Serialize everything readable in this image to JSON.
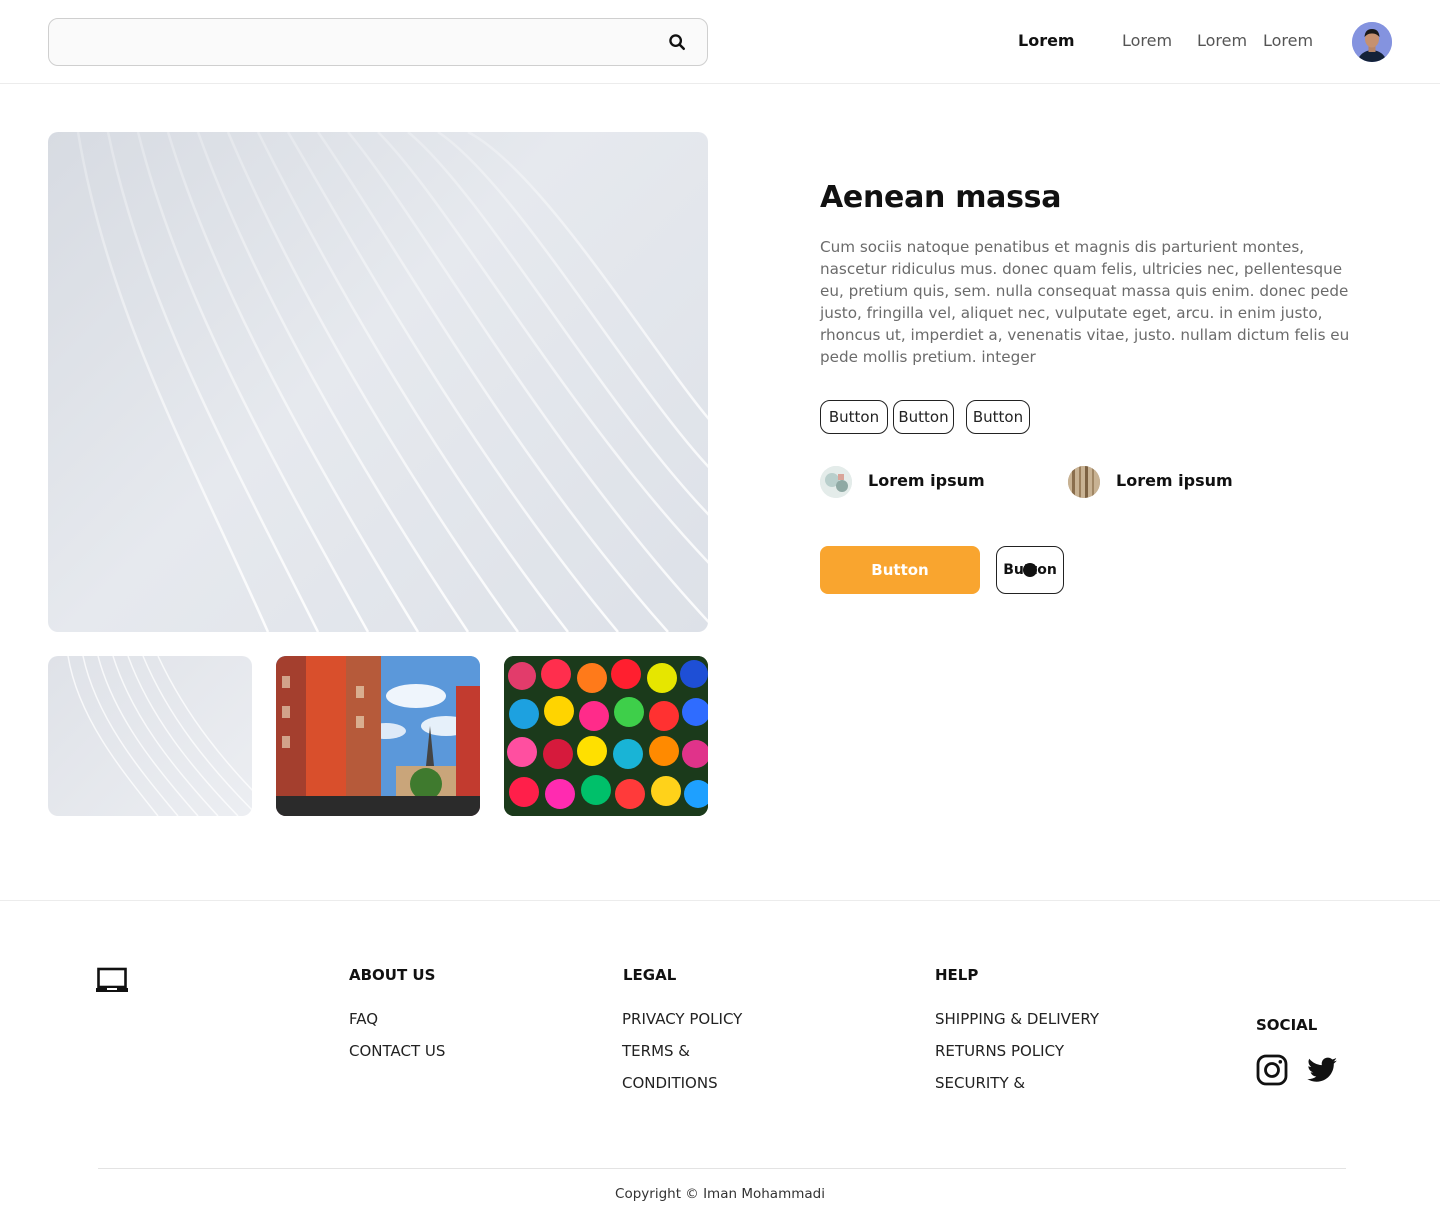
{
  "header": {
    "search": {
      "placeholder": "",
      "value": ""
    },
    "nav": [
      "Lorem",
      "Lorem",
      "Lorem",
      "Lorem"
    ],
    "active_nav_index": 0
  },
  "product": {
    "title": "Aenean massa",
    "description": "Cum sociis natoque penatibus et magnis dis parturient montes, nascetur ridiculus mus. donec quam felis, ultricies nec, pellentesque eu, pretium quis, sem. nulla consequat massa quis enim. donec pede justo, fringilla vel, aliquet nec, vulputate eget, arcu. in enim justo, rhoncus ut, imperdiet a, venenatis vitae, justo. nullam dictum felis eu pede mollis pretium. integer",
    "option_buttons": [
      "Button",
      "Button",
      "Button"
    ],
    "swatches": [
      "Lorem ipsum",
      "Lorem ipsum"
    ],
    "primary_button": "Button",
    "secondary_button": "Button",
    "accent_color": "#f9a52f"
  },
  "footer": {
    "columns": [
      {
        "title": "ABOUT US",
        "links": [
          "FAQ",
          "CONTACT US"
        ]
      },
      {
        "title": "LEGAL",
        "links": [
          "PRIVACY POLICY",
          "TERMS &",
          "CONDITIONS"
        ]
      },
      {
        "title": "HELP",
        "links": [
          "SHIPPING & DELIVERY",
          "RETURNS POLICY",
          "SECURITY &"
        ]
      }
    ],
    "social_title": "SOCIAL",
    "social_icons": [
      "instagram-icon",
      "twitter-icon"
    ],
    "copyright": "Copyright © Iman Mohammadi"
  }
}
